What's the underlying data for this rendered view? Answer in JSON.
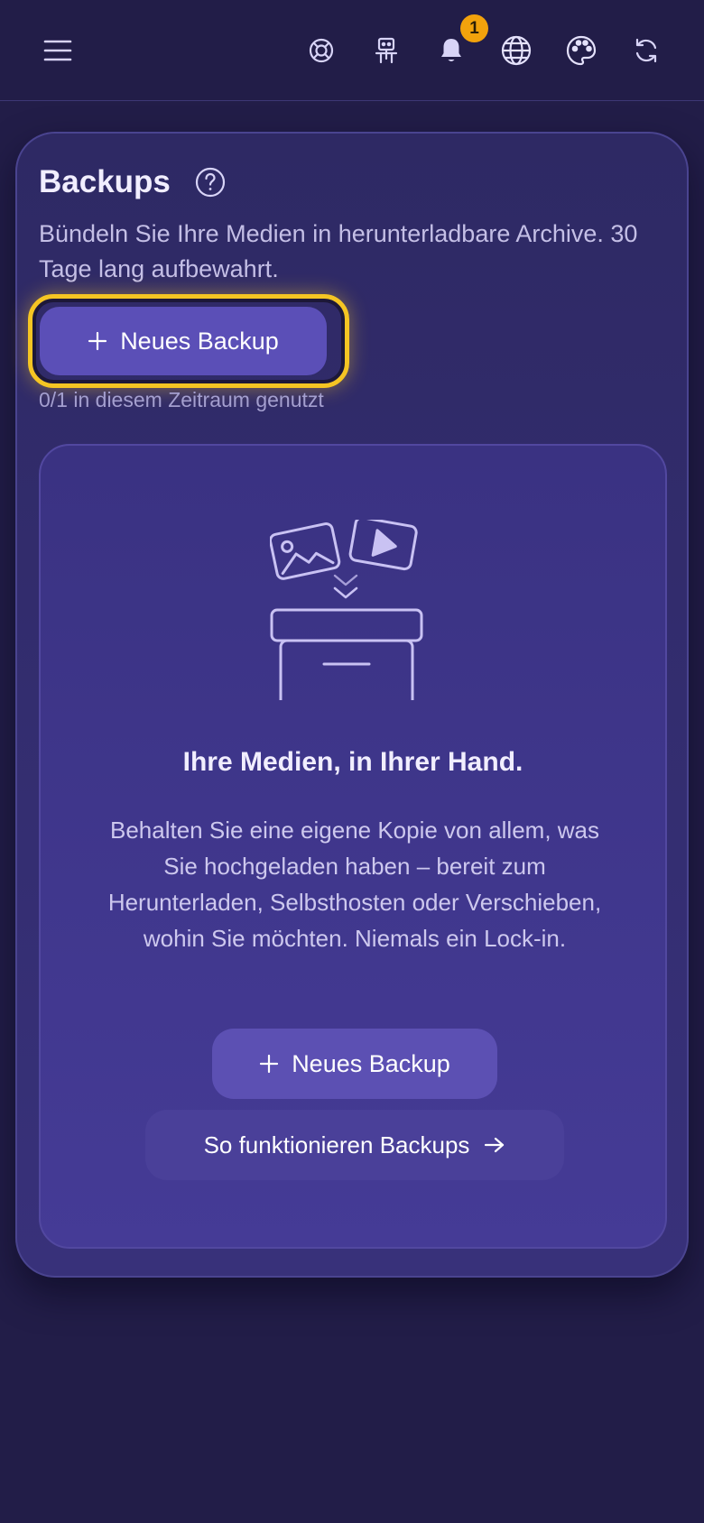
{
  "topbar": {
    "menu_icon": "hamburger-menu-icon",
    "icons": [
      "lifebuoy-icon",
      "robot-icon",
      "bell-icon",
      "globe-icon",
      "palette-icon",
      "refresh-icon"
    ],
    "notification_count": "1",
    "badge_color": "#f2a20c"
  },
  "backups": {
    "title": "Backups",
    "description": "Bündeln Sie Ihre Medien in herunterladbare Archive. 30 Tage lang aufbewahrt.",
    "new_backup_label": "Neues Backup",
    "usage": "0/1 in diesem Zeitraum genutzt",
    "focus_ring_color": "#f5c523"
  },
  "empty_state": {
    "headline": "Ihre Medien, in Ihrer Hand.",
    "body": "Behalten Sie eine eigene Kopie von allem, was Sie hochgeladen haben – bereit zum Herunterladen, Selbsthosten oder Verschieben, wohin Sie möchten. Niemals ein Lock-in.",
    "new_backup_label": "Neues Backup",
    "how_it_works_label": "So funktionieren Backups"
  }
}
